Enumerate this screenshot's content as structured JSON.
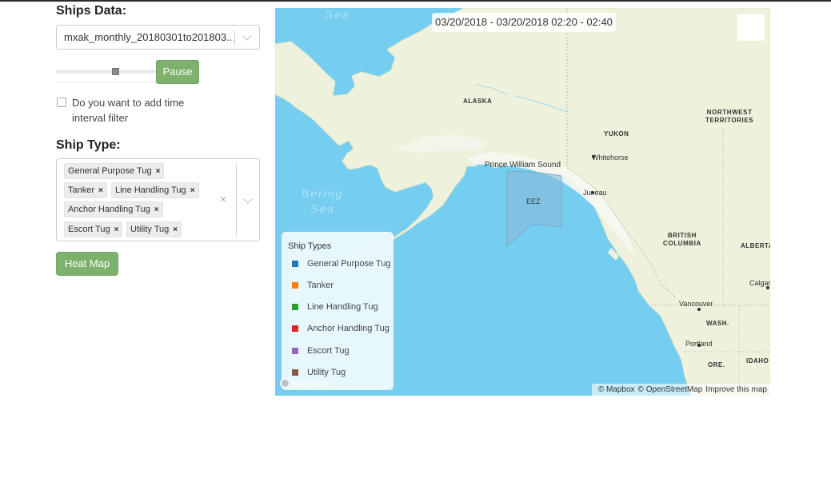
{
  "sidebar": {
    "ships_data_heading": "Ships Data:",
    "file_select_value": "mxak_monthly_20180301to201803...",
    "pause_button": "Pause",
    "time_filter_label": "Do you want to add time interval filter",
    "ship_type_heading": "Ship Type:",
    "ship_types_selected": [
      "General Purpose Tug",
      "Tanker",
      "Line Handling Tug",
      "Anchor Handling Tug",
      "Escort Tug",
      "Utility Tug"
    ],
    "chip_remove_glyph": "×",
    "clear_glyph": "×",
    "heat_map_button": "Heat Map"
  },
  "map": {
    "time_label": "03/20/2018 - 03/20/2018 02:20 - 02:40",
    "sea_labels": [
      "Sea",
      "Bering",
      "Sea"
    ],
    "region_labels": {
      "alaska": "ALASKA",
      "yukon": "YUKON",
      "nwt_1": "NORTHWEST",
      "nwt_2": "TERRITORIES",
      "bc_1": "BRITISH",
      "bc_2": "COLUMBIA",
      "alberta": "ALBERTA",
      "wash": "WASH.",
      "ore": "ORE.",
      "idaho": "IDAHO"
    },
    "place_labels": {
      "prince_william": "Prince William Sound",
      "whitehorse": "Whitehorse",
      "juneau": "Juneau",
      "eez": "EEZ",
      "calgary": "Calgar",
      "vancouver": "Vancouver",
      "portland": "Portland"
    },
    "legend": {
      "title": "Ship Types",
      "items": [
        {
          "label": "General Purpose Tug",
          "color": "#1f77b4"
        },
        {
          "label": "Tanker",
          "color": "#ff7f0e"
        },
        {
          "label": "Line Handling Tug",
          "color": "#2ca02c"
        },
        {
          "label": "Anchor Handling Tug",
          "color": "#d62728"
        },
        {
          "label": "Escort Tug",
          "color": "#9467bd"
        },
        {
          "label": "Utility Tug",
          "color": "#8c564b"
        }
      ]
    },
    "logo_text": "mapbox",
    "attribution": {
      "mapbox": "© Mapbox",
      "osm": "© OpenStreetMap",
      "improve": "Improve this map"
    }
  },
  "colors": {
    "accent_button": "#7cb26c",
    "water": "#75cdf0",
    "land": "#eef2dc",
    "eez": "#8ab9d8"
  }
}
